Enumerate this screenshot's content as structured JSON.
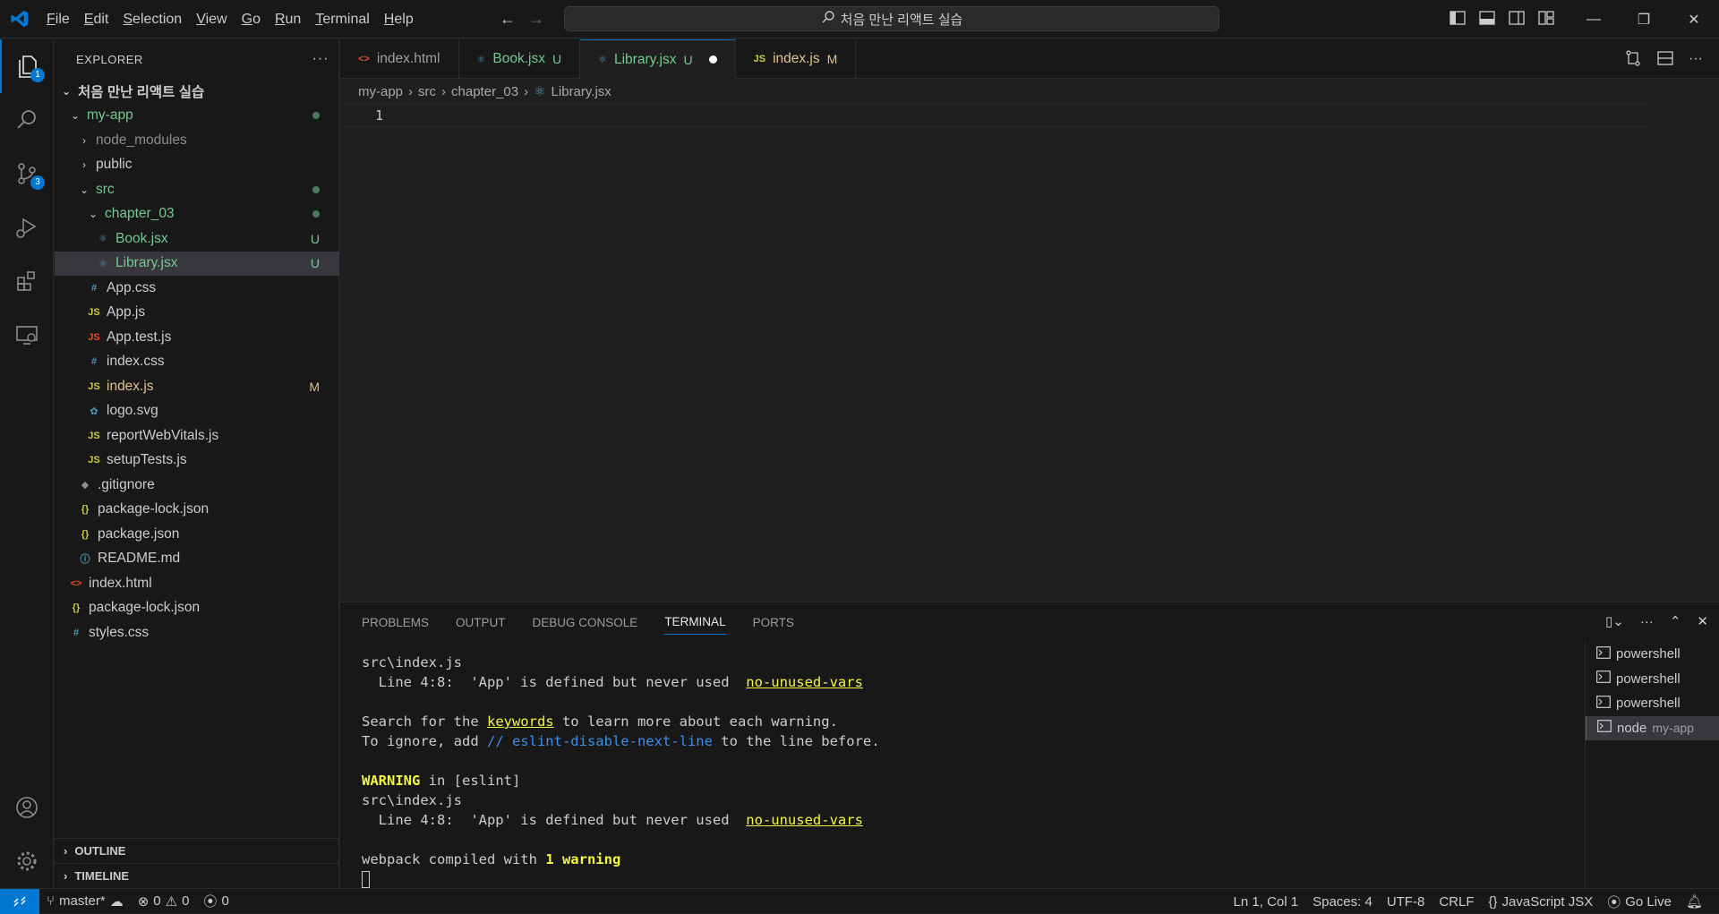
{
  "menu": [
    "File",
    "Edit",
    "Selection",
    "View",
    "Go",
    "Run",
    "Terminal",
    "Help"
  ],
  "search": {
    "text": "처음 만난 리액트 실습"
  },
  "activity": {
    "explorer_badge": "1",
    "scm_badge": "3"
  },
  "sidebar": {
    "title": "EXPLORER",
    "more": "···",
    "root": "처음 만난 리액트 실습",
    "items": [
      {
        "label": "my-app",
        "chev": "⌄",
        "indent": 1,
        "icon": "",
        "cls": "green",
        "dot": true
      },
      {
        "label": "node_modules",
        "chev": "›",
        "indent": 2,
        "icon": "",
        "cls": "dim"
      },
      {
        "label": "public",
        "chev": "›",
        "indent": 2,
        "icon": "",
        "cls": ""
      },
      {
        "label": "src",
        "chev": "⌄",
        "indent": 2,
        "icon": "",
        "cls": "green",
        "dot": true
      },
      {
        "label": "chapter_03",
        "chev": "⌄",
        "indent": 3,
        "icon": "",
        "cls": "green",
        "dot": true
      },
      {
        "label": "Book.jsx",
        "chev": "",
        "indent": 4,
        "icon": "⚛",
        "iconcls": "react",
        "cls": "green",
        "stat": "U"
      },
      {
        "label": "Library.jsx",
        "chev": "",
        "indent": 4,
        "icon": "⚛",
        "iconcls": "react",
        "cls": "green",
        "stat": "U",
        "sel": true
      },
      {
        "label": "App.css",
        "chev": "",
        "indent": 3,
        "icon": "#",
        "iconcls": "hash",
        "cls": ""
      },
      {
        "label": "App.js",
        "chev": "",
        "indent": 3,
        "icon": "JS",
        "iconcls": "js",
        "cls": ""
      },
      {
        "label": "App.test.js",
        "chev": "",
        "indent": 3,
        "icon": "JS",
        "iconcls": "jsred",
        "cls": ""
      },
      {
        "label": "index.css",
        "chev": "",
        "indent": 3,
        "icon": "#",
        "iconcls": "hash",
        "cls": ""
      },
      {
        "label": "index.js",
        "chev": "",
        "indent": 3,
        "icon": "JS",
        "iconcls": "js",
        "cls": "mod",
        "stat": "M"
      },
      {
        "label": "logo.svg",
        "chev": "",
        "indent": 3,
        "icon": "✿",
        "iconcls": "react",
        "cls": ""
      },
      {
        "label": "reportWebVitals.js",
        "chev": "",
        "indent": 3,
        "icon": "JS",
        "iconcls": "js",
        "cls": ""
      },
      {
        "label": "setupTests.js",
        "chev": "",
        "indent": 3,
        "icon": "JS",
        "iconcls": "js",
        "cls": ""
      },
      {
        "label": ".gitignore",
        "chev": "",
        "indent": 2,
        "icon": "◆",
        "iconcls": "dim",
        "cls": ""
      },
      {
        "label": "package-lock.json",
        "chev": "",
        "indent": 2,
        "icon": "{}",
        "iconcls": "json",
        "cls": ""
      },
      {
        "label": "package.json",
        "chev": "",
        "indent": 2,
        "icon": "{}",
        "iconcls": "json",
        "cls": ""
      },
      {
        "label": "README.md",
        "chev": "",
        "indent": 2,
        "icon": "ⓘ",
        "iconcls": "hash",
        "cls": ""
      },
      {
        "label": "index.html",
        "chev": "",
        "indent": 1,
        "icon": "<>",
        "iconcls": "html",
        "cls": ""
      },
      {
        "label": "package-lock.json",
        "chev": "",
        "indent": 1,
        "icon": "{}",
        "iconcls": "json",
        "cls": ""
      },
      {
        "label": "styles.css",
        "chev": "",
        "indent": 1,
        "icon": "#",
        "iconcls": "hash",
        "cls": ""
      }
    ],
    "outline": "OUTLINE",
    "timeline": "TIMELINE"
  },
  "tabs": [
    {
      "label": "index.html",
      "icon": "<>",
      "iconcls": "html",
      "stat": "",
      "cls": ""
    },
    {
      "label": "Book.jsx",
      "icon": "⚛",
      "iconcls": "react",
      "stat": "U",
      "cls": "green"
    },
    {
      "label": "Library.jsx",
      "icon": "⚛",
      "iconcls": "react",
      "stat": "U",
      "cls": "green",
      "active": true
    },
    {
      "label": "index.js",
      "icon": "JS",
      "iconcls": "js",
      "stat": "M",
      "cls": "mod"
    }
  ],
  "breadcrumb": [
    "my-app",
    "src",
    "chapter_03",
    "Library.jsx"
  ],
  "editor": {
    "line": "1"
  },
  "panel": {
    "tabs": [
      "PROBLEMS",
      "OUTPUT",
      "DEBUG CONSOLE",
      "TERMINAL",
      "PORTS"
    ],
    "active": "TERMINAL",
    "terminal": {
      "l1": "src\\index.js",
      "l2a": "  Line 4:8:  'App' is defined but never used  ",
      "l2b": "no-unused-vars",
      "l4a": "Search for the ",
      "l4b": "keywords",
      "l4c": " to learn more about each warning.",
      "l5a": "To ignore, add ",
      "l5b": "// eslint-disable-next-line",
      "l5c": " to the line before.",
      "l7a": "WARNING",
      "l7b": " in [eslint]",
      "l8": "src\\index.js",
      "l9a": "  Line 4:8:  'App' is defined but never used  ",
      "l9b": "no-unused-vars",
      "l11a": "webpack compiled with ",
      "l11b": "1 warning"
    },
    "terminals": [
      {
        "name": "powershell",
        "sub": ""
      },
      {
        "name": "powershell",
        "sub": ""
      },
      {
        "name": "powershell",
        "sub": ""
      },
      {
        "name": "node",
        "sub": "my-app",
        "active": true
      }
    ]
  },
  "status": {
    "branch": "master*",
    "errors": "0",
    "warnings": "0",
    "ports": "0",
    "position": "Ln 1, Col 1",
    "spaces": "Spaces: 4",
    "encoding": "UTF-8",
    "eol": "CRLF",
    "language": "JavaScript JSX",
    "golive": "Go Live"
  }
}
